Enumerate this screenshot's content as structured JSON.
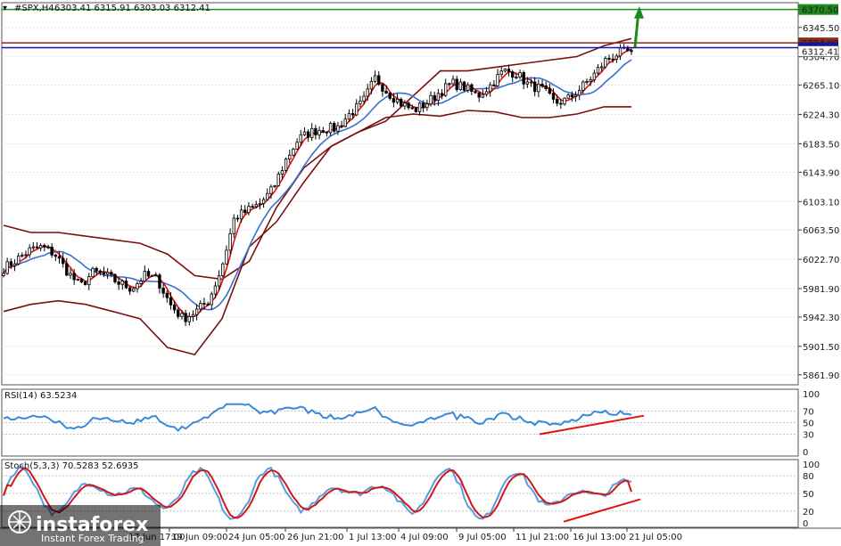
{
  "header": {
    "symbol": "#SPX,H4",
    "ohlc": "6303.41 6315.91 6303.03 6312.41"
  },
  "colors": {
    "background": "#ffffff",
    "candles": "#000000",
    "bollinger": "#7a0f0f",
    "ma_fast": "#e01010",
    "ma_slow": "#3a6fd0",
    "resistance_green": "#1e8a1e",
    "level_brown": "#8b2c12",
    "level_blue": "#1414b4",
    "divergence": "#e01010"
  },
  "levels": [
    {
      "name": "level-6370",
      "label": "6370.50",
      "value": 6370.5,
      "color": "#1e8a1e"
    },
    {
      "name": "level-6324",
      "label": "6324.00",
      "value": 6324.0,
      "color": "#8b2c12"
    },
    {
      "name": "level-6317",
      "label": "6317.45",
      "value": 6317.45,
      "color": "#1414b4"
    }
  ],
  "price_axis": [
    "6345.50",
    "6304.70",
    "6265.10",
    "6224.30",
    "6183.50",
    "6143.90",
    "6103.10",
    "6063.50",
    "6022.70",
    "5981.90",
    "5942.30",
    "5901.50",
    "5861.90"
  ],
  "current_price": {
    "label": "6312.41",
    "value": 6312.41
  },
  "time_axis": [
    "17 Jun 17:00",
    "19 Jun 09:00",
    "24 Jun 05:00",
    "26 Jun 21:00",
    "1 Jul 13:00",
    "4 Jul 09:00",
    "9 Jul 05:00",
    "11 Jul 21:00",
    "16 Jul 13:00",
    "21 Jul 05:00"
  ],
  "rsi": {
    "label": "RSI(14) 63.5234",
    "axis": [
      "100",
      "70",
      "50",
      "30",
      "0"
    ]
  },
  "stoch": {
    "label": "Stoch(5,3,3) 70.5283 52.6935",
    "axis": [
      "100",
      "80",
      "50",
      "20",
      "0"
    ]
  },
  "watermark": {
    "brand": "instaforex",
    "tagline": "Instant Forex Trading"
  },
  "chart_data": {
    "type": "candlestick",
    "title": "#SPX,H4",
    "x_ticks": [
      "17 Jun 17:00",
      "19 Jun 09:00",
      "24 Jun 05:00",
      "26 Jun 21:00",
      "1 Jul 13:00",
      "4 Jul 09:00",
      "9 Jul 05:00",
      "11 Jul 21:00",
      "16 Jul 13:00",
      "21 Jul 05:00"
    ],
    "ylim": [
      5848,
      6380
    ],
    "close_path": [
      6010,
      6022,
      6035,
      6040,
      6030,
      6005,
      5985,
      6005,
      6000,
      5990,
      5982,
      6000,
      5995,
      5960,
      5940,
      5950,
      5965,
      6010,
      6080,
      6090,
      6100,
      6120,
      6160,
      6190,
      6200,
      6205,
      6205,
      6225,
      6240,
      6275,
      6255,
      6240,
      6230,
      6240,
      6255,
      6268,
      6262,
      6250,
      6265,
      6285,
      6282,
      6265,
      6260,
      6240,
      6245,
      6260,
      6278,
      6300,
      6310,
      6312
    ],
    "bollinger_upper": [
      6070,
      6060,
      6060,
      6055,
      6050,
      6045,
      6030,
      6000,
      5995,
      6020,
      6095,
      6150,
      6180,
      6200,
      6215,
      6250,
      6285,
      6285,
      6290,
      6295,
      6300,
      6305,
      6320,
      6330
    ],
    "bollinger_lower": [
      5950,
      5960,
      5965,
      5960,
      5950,
      5940,
      5900,
      5890,
      5940,
      6040,
      6075,
      6130,
      6180,
      6200,
      6220,
      6225,
      6222,
      6230,
      6228,
      6220,
      6220,
      6225,
      6235,
      6235
    ],
    "rsi_value": 63.5234,
    "stoch_k": 70.5283,
    "stoch_d": 52.6935
  }
}
